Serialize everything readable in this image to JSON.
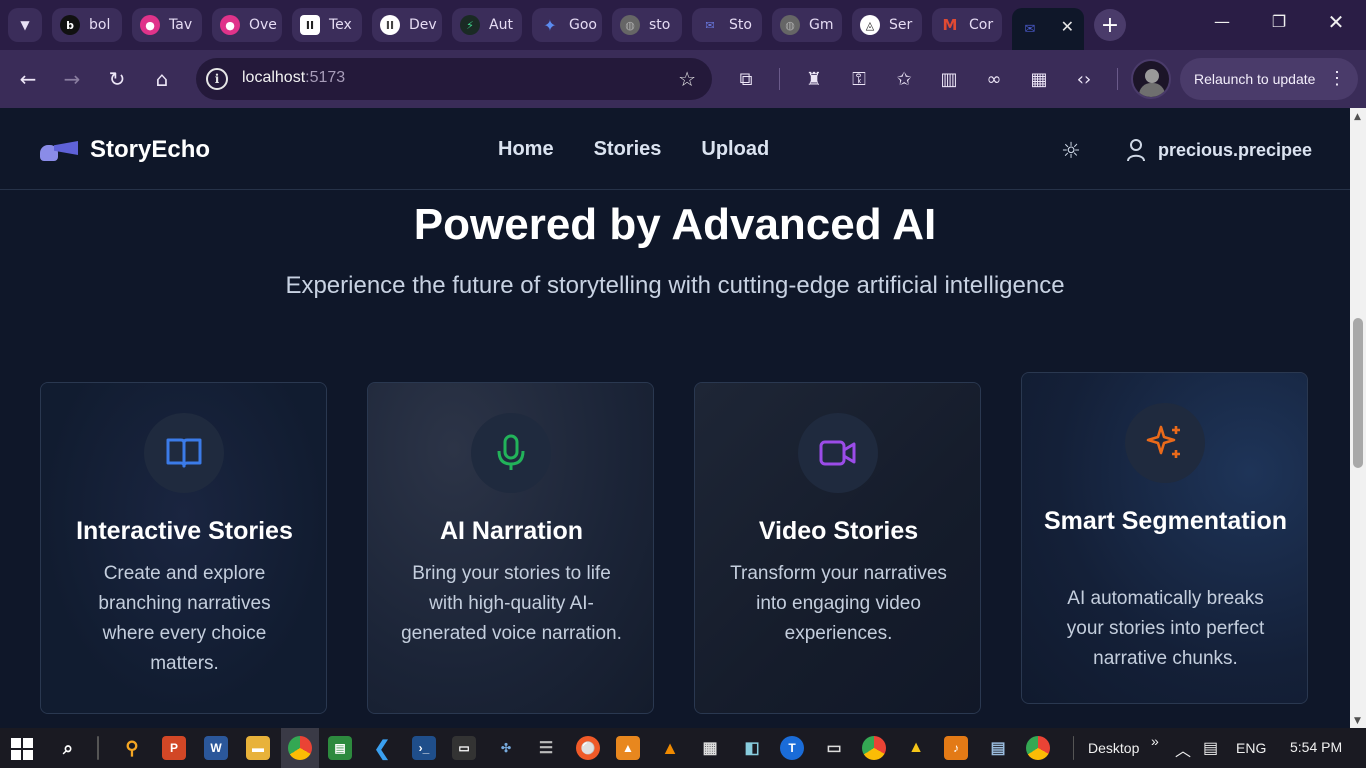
{
  "browser": {
    "tabs": [
      {
        "label": "bol",
        "favicon": "b",
        "color": "#111111"
      },
      {
        "label": "Tav",
        "favicon": "●",
        "color": "#e0338a"
      },
      {
        "label": "Ove",
        "favicon": "●",
        "color": "#e0338a"
      },
      {
        "label": "Tex",
        "favicon": "II",
        "color": "#222222"
      },
      {
        "label": "Dev",
        "favicon": "II",
        "color": "#444444"
      },
      {
        "label": "Aut",
        "favicon": "⚡",
        "color": "#1e7d5a"
      },
      {
        "label": "Goo",
        "favicon": "✦",
        "color": "#3a6fe0"
      },
      {
        "label": "sto",
        "favicon": "◍",
        "color": "#666666"
      },
      {
        "label": "Sto",
        "favicon": "✉",
        "color": "#4b5ac8"
      },
      {
        "label": "Gm",
        "favicon": "◍",
        "color": "#666666"
      },
      {
        "label": "Ser",
        "favicon": "◬",
        "color": "#222222"
      },
      {
        "label": "Cor",
        "favicon": "M",
        "color": "#d9402b"
      }
    ],
    "active_tab_close": "✕",
    "new_tab": "+",
    "address": {
      "host": "localhost",
      "port": ":5173"
    },
    "relaunch_label": "Relaunch to update"
  },
  "app": {
    "brand": "StoryEcho",
    "nav": [
      "Home",
      "Stories",
      "Upload"
    ],
    "username": "precious.precipee"
  },
  "hero": {
    "title": "Powered by Advanced AI",
    "subtitle": "Experience the future of storytelling with cutting-edge artificial intelligence"
  },
  "features": [
    {
      "title": "Interactive Stories",
      "description": "Create and explore branching narratives where every choice matters.",
      "icon": "book-open-icon",
      "icon_color": "#3b7be8"
    },
    {
      "title": "AI Narration",
      "description": "Bring your stories to life with high-quality AI-generated voice narration.",
      "icon": "microphone-icon",
      "icon_color": "#22b35a"
    },
    {
      "title": "Video Stories",
      "description": "Transform your narratives into engaging video experiences.",
      "icon": "video-camera-icon",
      "icon_color": "#9b4ce8"
    },
    {
      "title": "Smart Segmentation",
      "description": "AI automatically breaks your stories into perfect narrative chunks.",
      "icon": "sparkles-icon",
      "icon_color": "#ea6a1a"
    }
  ],
  "taskbar": {
    "desktop_label": "Desktop",
    "language": "ENG",
    "time": "5:54 PM"
  }
}
